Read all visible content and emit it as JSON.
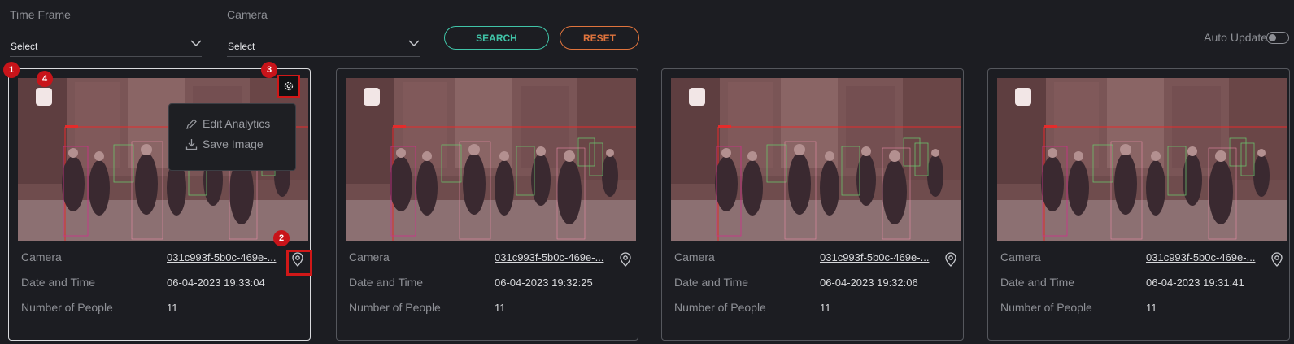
{
  "filters": {
    "time_frame": {
      "label": "Time Frame",
      "value": "Select"
    },
    "camera": {
      "label": "Camera",
      "value": "Select"
    }
  },
  "buttons": {
    "search": "SEARCH",
    "reset": "RESET"
  },
  "auto_update": {
    "label": "Auto Update",
    "enabled": false
  },
  "field_labels": {
    "camera": "Camera",
    "date_time": "Date and Time",
    "people": "Number of People"
  },
  "cards": [
    {
      "camera_id": "031c993f-5b0c-469e-...",
      "datetime": "06-04-2023 19:33:04",
      "people": "11"
    },
    {
      "camera_id": "031c993f-5b0c-469e-...",
      "datetime": "06-04-2023 19:32:25",
      "people": "11"
    },
    {
      "camera_id": "031c993f-5b0c-469e-...",
      "datetime": "06-04-2023 19:32:06",
      "people": "11"
    },
    {
      "camera_id": "031c993f-5b0c-469e-...",
      "datetime": "06-04-2023 19:31:41",
      "people": "11"
    }
  ],
  "context_menu": {
    "items": [
      "Edit Analytics",
      "Save Image"
    ]
  },
  "markers": [
    "1",
    "2",
    "3",
    "4"
  ],
  "colors": {
    "accent_search": "#40c4a8",
    "accent_reset": "#e0743d",
    "highlight": "#d01818"
  },
  "icons": {
    "gear": "gear-icon",
    "pin": "location-pin-icon",
    "chevron": "chevron-down-icon",
    "edit": "pencil-icon",
    "save": "download-icon"
  }
}
